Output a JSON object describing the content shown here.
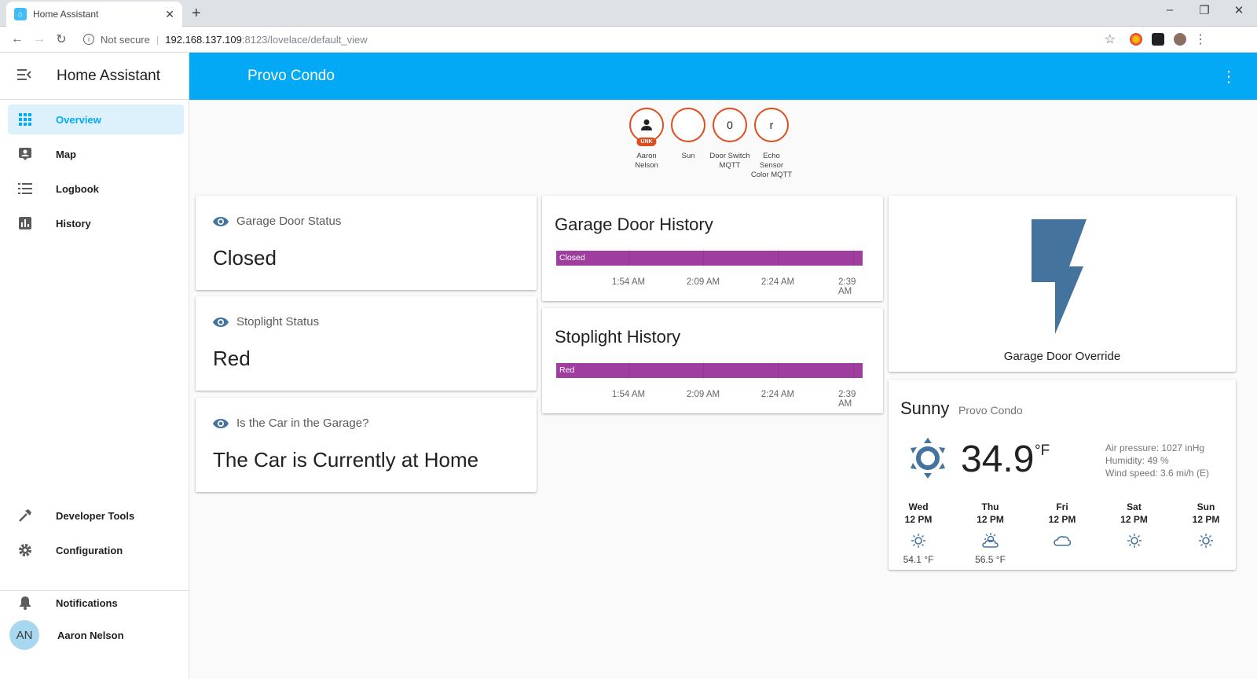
{
  "browser": {
    "tab_title": "Home Assistant",
    "new_tab": "+",
    "security_label": "Not secure",
    "url_host": "192.168.137.109",
    "url_rest": ":8123/lovelace/default_view"
  },
  "sidebar": {
    "title": "Home Assistant",
    "items": [
      {
        "label": "Overview",
        "icon": "grid-icon",
        "active": true
      },
      {
        "label": "Map",
        "icon": "map-icon"
      },
      {
        "label": "Logbook",
        "icon": "list-icon"
      },
      {
        "label": "History",
        "icon": "chart-icon"
      }
    ],
    "bottom_items": [
      {
        "label": "Developer Tools",
        "icon": "hammer-icon"
      },
      {
        "label": "Configuration",
        "icon": "gear-icon"
      }
    ],
    "notifications_label": "Notifications",
    "user_initials": "AN",
    "user_name": "Aaron Nelson"
  },
  "header": {
    "title": "Provo Condo"
  },
  "badges": [
    {
      "label": "Aaron Nelson",
      "status": "UNK",
      "icon": "person-icon"
    },
    {
      "label": "Sun",
      "icon": "moon-icon"
    },
    {
      "label": "Door Switch MQTT",
      "value": "0"
    },
    {
      "label": "Echo Sensor Color MQTT",
      "value": "r"
    }
  ],
  "entity_cards": [
    {
      "title": "Garage Door Status",
      "value": "Closed"
    },
    {
      "title": "Stoplight Status",
      "value": "Red"
    },
    {
      "title": "Is the Car in the Garage?",
      "value": "The Car is Currently at Home"
    }
  ],
  "history_cards": [
    {
      "title": "Garage Door History",
      "state": "Closed",
      "ticks": [
        "1:54 AM",
        "2:09 AM",
        "2:24 AM",
        "2:39 AM"
      ]
    },
    {
      "title": "Stoplight History",
      "state": "Red",
      "ticks": [
        "1:54 AM",
        "2:09 AM",
        "2:24 AM",
        "2:39 AM"
      ]
    }
  ],
  "button_card": {
    "name": "Garage Door Override",
    "icon": "flash-icon"
  },
  "weather": {
    "state": "Sunny",
    "name": "Provo Condo",
    "temperature": "34.9",
    "unit": "°F",
    "air_pressure": "Air pressure: 1027 inHg",
    "humidity": "Humidity: 49 %",
    "wind_speed": "Wind speed: 3.6 mi/h (E)",
    "forecast": [
      {
        "day": "Wed",
        "time": "12 PM",
        "icon": "sun-icon",
        "temp": "54.1 °F"
      },
      {
        "day": "Thu",
        "time": "12 PM",
        "icon": "partly-cloudy-icon",
        "temp": "56.5 °F"
      },
      {
        "day": "Fri",
        "time": "12 PM",
        "icon": "cloud-icon",
        "temp": ""
      },
      {
        "day": "Sat",
        "time": "12 PM",
        "icon": "sun-icon",
        "temp": ""
      },
      {
        "day": "Sun",
        "time": "12 PM",
        "icon": "sun-icon",
        "temp": ""
      }
    ]
  },
  "colors": {
    "accent": "#03a9f4",
    "icon_blue": "#44739e",
    "badge_border": "#df4c1e",
    "history_bar": "#a03ea0"
  }
}
